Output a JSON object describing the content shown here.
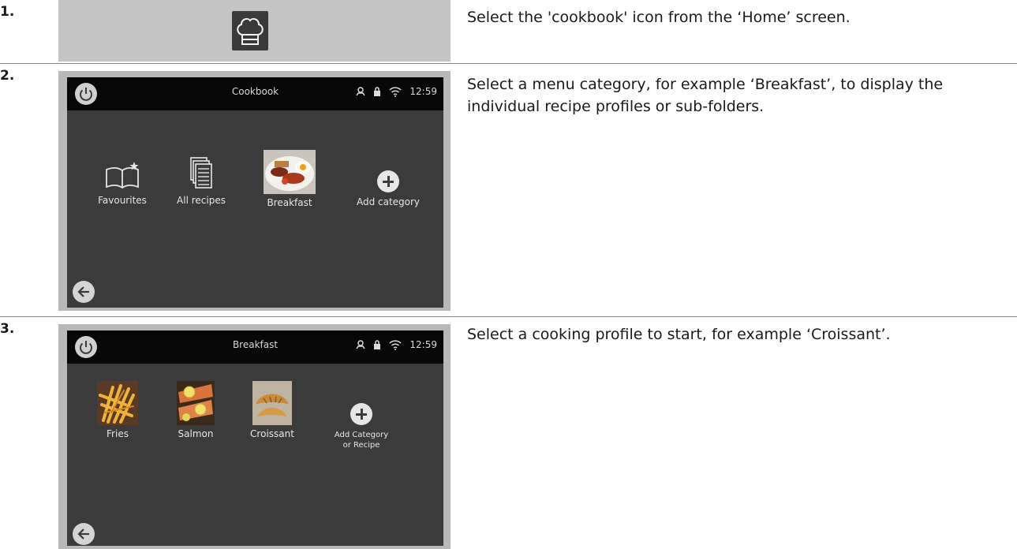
{
  "steps": [
    {
      "number": "1.",
      "instruction": "Select the 'cookbook' icon from the ‘Home’ screen.",
      "icon": "chef-hat-icon"
    },
    {
      "number": "2.",
      "instruction": "Select a menu category, for example ‘Breakfast’, to display the individual recipe profiles or sub-folders.",
      "screen": {
        "title": "Cookbook",
        "time": "12:59",
        "status_icons": [
          "person-icon",
          "lock-icon",
          "wifi-icon"
        ],
        "tiles": [
          {
            "label": "Favourites",
            "icon": "book-star-icon"
          },
          {
            "label": "All recipes",
            "icon": "documents-icon"
          },
          {
            "label": "Breakfast",
            "icon": "breakfast-photo"
          },
          {
            "label": "Add category",
            "icon": "plus-circle-icon"
          }
        ]
      }
    },
    {
      "number": "3.",
      "instruction": "Select a cooking profile to start, for example ‘Croissant’.",
      "screen": {
        "title": "Breakfast",
        "time": "12:59",
        "status_icons": [
          "person-icon",
          "lock-icon",
          "wifi-icon"
        ],
        "tiles": [
          {
            "label": "Fries",
            "icon": "fries-photo"
          },
          {
            "label": "Salmon",
            "icon": "salmon-photo"
          },
          {
            "label": "Croissant",
            "icon": "croissant-photo"
          },
          {
            "label": "Add Category",
            "label2": "or Recipe",
            "icon": "plus-circle-icon"
          }
        ]
      }
    }
  ],
  "colors": {
    "screen_bg": "#3b3b3b",
    "topbar_bg": "#070707",
    "frame": "#b8b8b8",
    "step1_bar": "#c4c4c4"
  }
}
